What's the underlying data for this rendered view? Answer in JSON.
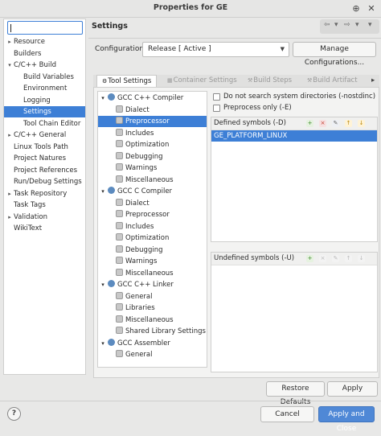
{
  "window": {
    "title": "Properties for GE",
    "buttons": {
      "maximize": "⊕",
      "close": "✕"
    }
  },
  "left_pane": {
    "filter": {
      "value": "",
      "placeholder": ""
    },
    "items": [
      {
        "label": "Resource",
        "expandable": true,
        "expanded": false,
        "selected": false,
        "indent": 0
      },
      {
        "label": "Builders",
        "expandable": false,
        "expanded": false,
        "selected": false,
        "indent": 0
      },
      {
        "label": "C/C++ Build",
        "expandable": true,
        "expanded": true,
        "selected": false,
        "indent": 0
      },
      {
        "label": "Build Variables",
        "expandable": false,
        "expanded": false,
        "selected": false,
        "indent": 1
      },
      {
        "label": "Environment",
        "expandable": false,
        "expanded": false,
        "selected": false,
        "indent": 1
      },
      {
        "label": "Logging",
        "expandable": false,
        "expanded": false,
        "selected": false,
        "indent": 1
      },
      {
        "label": "Settings",
        "expandable": false,
        "expanded": false,
        "selected": true,
        "indent": 1
      },
      {
        "label": "Tool Chain Editor",
        "expandable": false,
        "expanded": false,
        "selected": false,
        "indent": 1
      },
      {
        "label": "C/C++ General",
        "expandable": true,
        "expanded": false,
        "selected": false,
        "indent": 0
      },
      {
        "label": "Linux Tools Path",
        "expandable": false,
        "expanded": false,
        "selected": false,
        "indent": 0
      },
      {
        "label": "Project Natures",
        "expandable": false,
        "expanded": false,
        "selected": false,
        "indent": 0
      },
      {
        "label": "Project References",
        "expandable": false,
        "expanded": false,
        "selected": false,
        "indent": 0
      },
      {
        "label": "Run/Debug Settings",
        "expandable": false,
        "expanded": false,
        "selected": false,
        "indent": 0
      },
      {
        "label": "Task Repository",
        "expandable": true,
        "expanded": false,
        "selected": false,
        "indent": 0
      },
      {
        "label": "Task Tags",
        "expandable": false,
        "expanded": false,
        "selected": false,
        "indent": 0
      },
      {
        "label": "Validation",
        "expandable": true,
        "expanded": false,
        "selected": false,
        "indent": 0
      },
      {
        "label": "WikiText",
        "expandable": false,
        "expanded": false,
        "selected": false,
        "indent": 0
      }
    ]
  },
  "settings": {
    "heading": "Settings",
    "nav": {
      "back": "⇦",
      "back_menu": "▾",
      "forward": "⇨",
      "forward_menu": "▾",
      "menu": "▾"
    },
    "configuration_label": "Configuration:",
    "configuration_value": "Release  [ Active ]",
    "manage_button": "Manage Configurations...",
    "tabs": [
      {
        "label": "Tool Settings",
        "active": true
      },
      {
        "label": "Container Settings",
        "active": false
      },
      {
        "label": "Build Steps",
        "active": false
      },
      {
        "label": "Build Artifact",
        "active": false
      }
    ],
    "tab_scroll": "▸"
  },
  "tool_tree": [
    {
      "label": "GCC C++ Compiler",
      "level": 0,
      "selected": false
    },
    {
      "label": "Dialect",
      "level": 1,
      "selected": false
    },
    {
      "label": "Preprocessor",
      "level": 1,
      "selected": true
    },
    {
      "label": "Includes",
      "level": 1,
      "selected": false
    },
    {
      "label": "Optimization",
      "level": 1,
      "selected": false
    },
    {
      "label": "Debugging",
      "level": 1,
      "selected": false
    },
    {
      "label": "Warnings",
      "level": 1,
      "selected": false
    },
    {
      "label": "Miscellaneous",
      "level": 1,
      "selected": false
    },
    {
      "label": "GCC C Compiler",
      "level": 0,
      "selected": false
    },
    {
      "label": "Dialect",
      "level": 1,
      "selected": false
    },
    {
      "label": "Preprocessor",
      "level": 1,
      "selected": false
    },
    {
      "label": "Includes",
      "level": 1,
      "selected": false
    },
    {
      "label": "Optimization",
      "level": 1,
      "selected": false
    },
    {
      "label": "Debugging",
      "level": 1,
      "selected": false
    },
    {
      "label": "Warnings",
      "level": 1,
      "selected": false
    },
    {
      "label": "Miscellaneous",
      "level": 1,
      "selected": false
    },
    {
      "label": "GCC C++ Linker",
      "level": 0,
      "selected": false
    },
    {
      "label": "General",
      "level": 1,
      "selected": false
    },
    {
      "label": "Libraries",
      "level": 1,
      "selected": false
    },
    {
      "label": "Miscellaneous",
      "level": 1,
      "selected": false
    },
    {
      "label": "Shared Library Settings",
      "level": 1,
      "selected": false
    },
    {
      "label": "GCC Assembler",
      "level": 0,
      "selected": false
    },
    {
      "label": "General",
      "level": 1,
      "selected": false
    }
  ],
  "preprocessor": {
    "nostdinc_label": "Do not search system directories (-nostdinc)",
    "nostdinc_checked": false,
    "preprocess_only_label": "Preprocess only (-E)",
    "preprocess_only_checked": false,
    "defined_header": "Defined symbols (-D)",
    "defined_symbols": [
      "GE_PLATFORM_LINUX"
    ],
    "undefined_header": "Undefined symbols (-U)",
    "undefined_symbols": []
  },
  "buttons": {
    "restore_defaults": "Restore Defaults",
    "apply": "Apply",
    "cancel": "Cancel",
    "apply_and_close": "Apply and Close",
    "help": "?"
  },
  "colors": {
    "selection": "#3d7fd6",
    "primary_button": "#4f88d6"
  }
}
